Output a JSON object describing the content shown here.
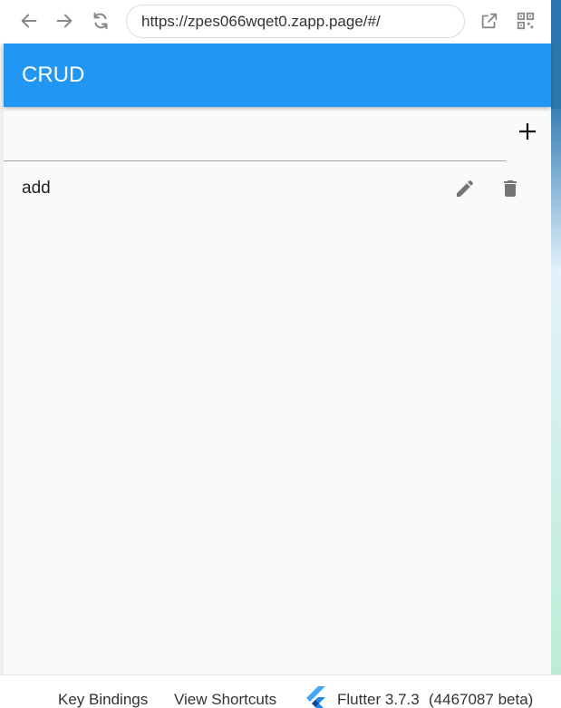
{
  "browser": {
    "url": "https://zpes066wqet0.zapp.page/#/",
    "icons": [
      "back-arrow-icon",
      "forward-arrow-icon",
      "reload-icon",
      "open-external-icon",
      "qr-code-icon"
    ]
  },
  "app": {
    "title": "CRUD",
    "accent_color": "#2196f3",
    "input": {
      "value": "",
      "placeholder": ""
    },
    "items": [
      {
        "label": "add"
      }
    ]
  },
  "footer": {
    "key_bindings": "Key Bindings",
    "view_shortcuts": "View Shortcuts",
    "flutter_version": "Flutter 3.7.3",
    "build": "(4467087 beta)"
  }
}
